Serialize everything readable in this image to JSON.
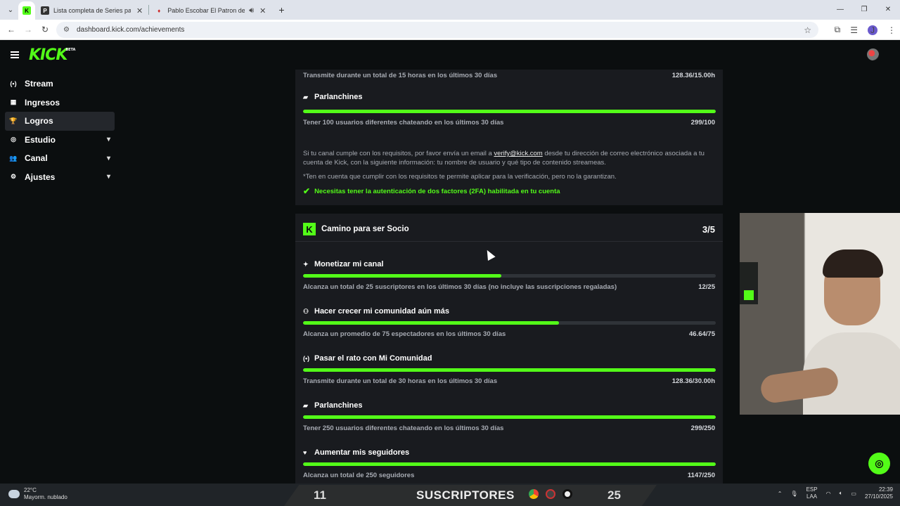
{
  "browser": {
    "tabs": [
      {
        "title": "",
        "favicon": "K",
        "active": true
      },
      {
        "title": "Lista completa de Series pagin",
        "favicon": "P",
        "active": false
      },
      {
        "title": "Pablo Escobar El Patron del",
        "favicon": "♦",
        "active": false
      }
    ],
    "url": "dashboard.kick.com/achievements",
    "profile_initial": "J"
  },
  "header": {
    "logo": "KICK",
    "logo_badge": "BETA"
  },
  "sidebar": {
    "items": [
      {
        "label": "Stream",
        "icon": "(•)",
        "chevron": false
      },
      {
        "label": "Ingresos",
        "icon": "▦",
        "chevron": false
      },
      {
        "label": "Logros",
        "icon": "🏆",
        "chevron": false,
        "active": true
      },
      {
        "label": "Estudio",
        "icon": "◎",
        "chevron": true
      },
      {
        "label": "Canal",
        "icon": "👥",
        "chevron": true
      },
      {
        "label": "Ajustes",
        "icon": "⚙",
        "chevron": true
      }
    ]
  },
  "verification": {
    "top_desc": "Transmite durante un total de 15 horas en los últimos 30 días",
    "top_value": "128.36/15.00h",
    "chat_title": "Parlanchines",
    "chat_desc": "Tener 100 usuarios diferentes chateando en los últimos 30 días",
    "chat_value": "299/100",
    "chat_progress": 1.0,
    "info_pre": "Si tu canal cumple con los requisitos, por favor envía un email a ",
    "info_email": "verify@kick.com",
    "info_post": " desde tu dirección de correo electrónico asociada a tu cuenta de Kick, con la siguiente información: tu nombre de usuario y qué tipo de contenido streameas.",
    "note": "*Ten en cuenta que cumplir con los requisitos te permite aplicar para la verificación, pero no la garantizan.",
    "twofa": "Necesitas tener la autenticación de dos factores (2FA) habilitada en tu cuenta"
  },
  "partner": {
    "title": "Camino para ser Socio",
    "count": "3/5",
    "achievements": [
      {
        "title": "Monetizar mi canal",
        "icon": "✦",
        "desc": "Alcanza un total de 25 suscriptores en los últimos 30 días (no incluye las suscripciones regaladas)",
        "value": "12/25",
        "progress": 0.48
      },
      {
        "title": "Hacer crecer mi comunidad aún más",
        "icon": "⚇",
        "desc": "Alcanza un promedio de 75 espectadores en los últimos 30 días",
        "value": "46.64/75",
        "progress": 0.62
      },
      {
        "title": "Pasar el rato con Mi Comunidad",
        "icon": "(•)",
        "desc": "Transmite durante un total de 30 horas en los últimos 30 días",
        "value": "128.36/30.00h",
        "progress": 1.0
      },
      {
        "title": "Parlanchines",
        "icon": "▰",
        "desc": "Tener 250 usuarios diferentes chateando en los últimos 30 días",
        "value": "299/250",
        "progress": 1.0
      },
      {
        "title": "Aumentar mis seguidores",
        "icon": "♥",
        "desc": "Alcanza un total de 250 seguidores",
        "value": "1147/250",
        "progress": 1.0
      }
    ]
  },
  "taskbar": {
    "temp": "22°C",
    "weather": "Mayorm. nublado",
    "overlay_left": "11",
    "overlay_label": "SUSCRIPTORES",
    "overlay_right": "25",
    "lang1": "ESP",
    "lang2": "LAA",
    "time": "22:39",
    "date": "27/10/2025"
  }
}
